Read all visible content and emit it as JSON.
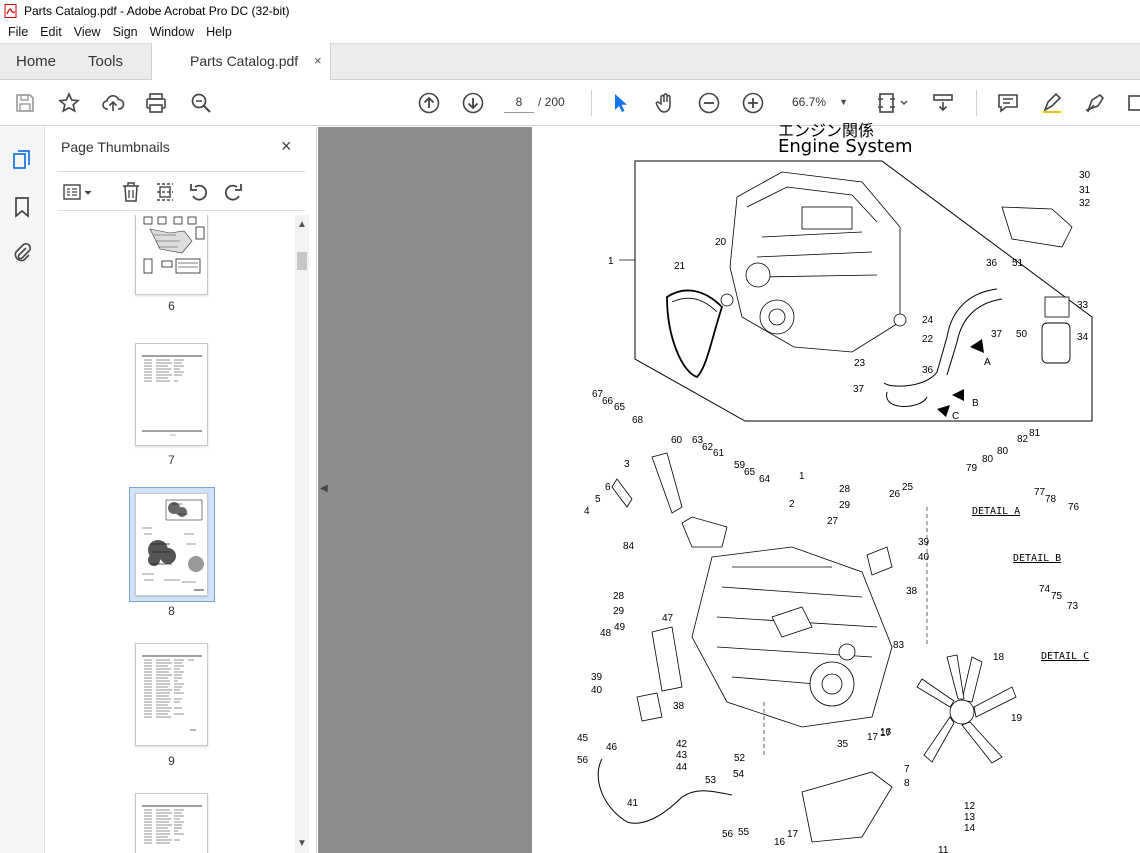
{
  "window": {
    "title": "Parts Catalog.pdf - Adobe Acrobat Pro DC (32-bit)"
  },
  "menu": [
    "File",
    "Edit",
    "View",
    "Sign",
    "Window",
    "Help"
  ],
  "tabs": {
    "home": "Home",
    "tools": "Tools",
    "document": "Parts Catalog.pdf",
    "close": "×"
  },
  "toolbar": {
    "page_current": "8",
    "page_total": "/ 200",
    "zoom": "66.7%"
  },
  "thumbnails_panel": {
    "title": "Page Thumbnails",
    "close": "×",
    "pages": [
      {
        "label": "6",
        "selected": false
      },
      {
        "label": "7",
        "selected": false
      },
      {
        "label": "8",
        "selected": true
      },
      {
        "label": "9",
        "selected": false
      }
    ]
  },
  "document": {
    "heading": "Engine System",
    "heading_cut": "エンジン関係",
    "detail_labels": [
      "DETAIL A",
      "DETAIL B",
      "DETAIL C"
    ],
    "callouts": [
      "1",
      "2",
      "3",
      "4",
      "5",
      "6",
      "7",
      "8",
      "11",
      "12",
      "13",
      "14",
      "16",
      "17",
      "18",
      "19",
      "20",
      "21",
      "22",
      "23",
      "24",
      "25",
      "26",
      "27",
      "28",
      "29",
      "30",
      "31",
      "32",
      "33",
      "34",
      "35",
      "36",
      "37",
      "38",
      "39",
      "40",
      "41",
      "42",
      "43",
      "44",
      "45",
      "46",
      "47",
      "48",
      "49",
      "50",
      "51",
      "52",
      "53",
      "54",
      "55",
      "56",
      "59",
      "60",
      "61",
      "62",
      "63",
      "64",
      "65",
      "66",
      "67",
      "68",
      "73",
      "74",
      "75",
      "76",
      "77",
      "78",
      "79",
      "80",
      "81",
      "82",
      "83",
      "84"
    ],
    "arrow_labels": [
      "A",
      "B",
      "C"
    ]
  },
  "colors": {
    "accent": "#1473e6",
    "doc_bg": "#8d8d8d",
    "selection": "#cfe2f7"
  }
}
